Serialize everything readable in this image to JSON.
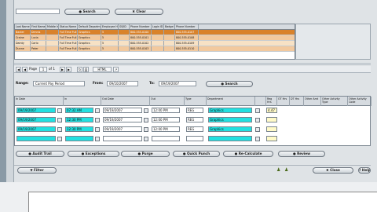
{
  "search": {
    "search_label": "Search",
    "clear_label": "Clear"
  },
  "employee_grid": {
    "headers": [
      "Last Name",
      "First Name",
      "Middle Initial",
      "Status Name",
      "Default Departmen",
      "Employee Ho",
      "SS/ID",
      "Phone Number",
      "Login ID",
      "Badge ID",
      "Phone Number"
    ],
    "rows": [
      [
        "Baxter",
        "Dennis",
        "",
        "Full Time Full Time",
        "Graphics",
        "5",
        "",
        "800-555-0100",
        "",
        "",
        "800-555-0107"
      ],
      [
        "Craine",
        "Lucia",
        "",
        "Full Time Full Time",
        "Graphics",
        "5",
        "",
        "800-555-0101",
        "",
        "",
        "800-555-0108"
      ],
      [
        "Dainty",
        "Carlo",
        "",
        "Full Time Full Time",
        "Graphics",
        "5",
        "",
        "800-555-0102",
        "",
        "",
        "800-555-0109"
      ],
      [
        "Dunne",
        "Peter",
        "",
        "Full Time Full Time",
        "Graphics",
        "5",
        "",
        "800-555-0103",
        "",
        "",
        "800-555-0110"
      ]
    ]
  },
  "toolbar": {
    "page_label": "Page",
    "page_value": "1",
    "of_label": "of 1",
    "format_value": "HTML"
  },
  "filters": {
    "range_label": "Range:",
    "range_value": "Current Pay Period",
    "from_label": "From:",
    "from_value": "09/10/2007",
    "to_label": "To:",
    "to_value": "09/19/2007",
    "search_label": "Search"
  },
  "punch_grid": {
    "headers": [
      "In Date",
      "In",
      "Out Date",
      "Out",
      "Type",
      "Department",
      "",
      "Reg Hrs",
      "OT Hrs",
      "DT Hrs",
      "Other Amt",
      "Other Activity Type",
      "Other Activity Code"
    ],
    "rows": [
      {
        "in_date": "09/19/2007",
        "in": "07:32 AM",
        "out_date": "09/19/2007",
        "out": "12:00 PM",
        "type": "REG",
        "dept": "Graphics",
        "hours": "4.47"
      },
      {
        "in_date": "09/19/2007",
        "in": "12:30 PM",
        "out_date": "09/19/2007",
        "out": "12:00 PM",
        "type": "REG",
        "dept": "Graphics",
        "hours": ""
      },
      {
        "in_date": "09/19/2007",
        "in": "12:30 PM",
        "out_date": "09/19/2007",
        "out": "12:00 PM",
        "type": "REG",
        "dept": "Graphics",
        "hours": ""
      },
      {
        "in_date": "",
        "in": "",
        "out_date": "",
        "out": "",
        "type": "",
        "dept": "",
        "hours": ""
      }
    ]
  },
  "actions": {
    "audit_trail": "Audit Trail",
    "exceptions": "Exceptions",
    "purge": "Purge",
    "quick_punch": "Quick Punch",
    "recalculate": "Re-Calculate",
    "review": "Review"
  },
  "footer": {
    "filter": "Filter",
    "close": "Close",
    "help": "Help"
  },
  "colors": {
    "selected_row": "#d9822b",
    "input_highlight": "#22e0e0"
  }
}
